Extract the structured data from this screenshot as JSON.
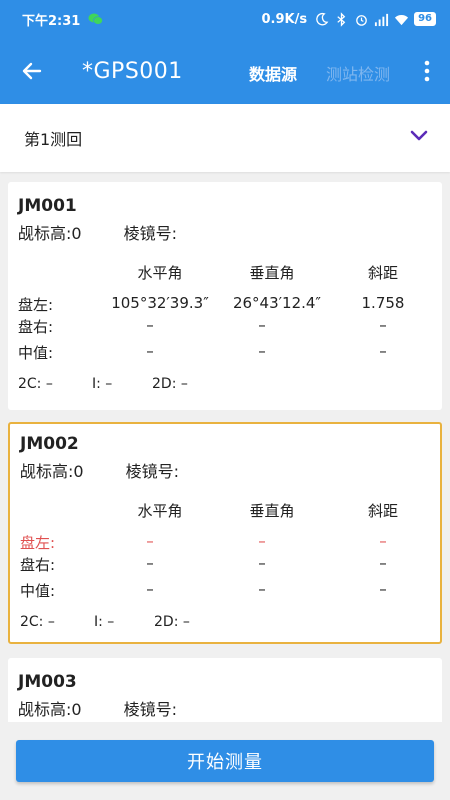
{
  "status": {
    "time": "下午2:31",
    "net_speed": "0.9K/s",
    "battery": "96"
  },
  "appbar": {
    "title": "*GPS001",
    "data_source": "数据源",
    "station_check": "测站检测"
  },
  "round_select": {
    "value": "第1测回"
  },
  "headers": {
    "h_angle": "水平角",
    "v_angle": "垂直角",
    "slope": "斜距",
    "left": "盘左:",
    "right": "盘右:",
    "mid": "中值:"
  },
  "cards": [
    {
      "id": "JM001",
      "target_height": "觇标高:0",
      "prism": "棱镜号:",
      "left": {
        "h": "105°32′39.3″",
        "v": "26°43′12.4″",
        "s": "1.758"
      },
      "right": {
        "h": "–",
        "v": "–",
        "s": "–"
      },
      "mid": {
        "h": "–",
        "v": "–",
        "s": "–"
      },
      "c2": "2C: –",
      "i": "I: –",
      "d2": "2D: –"
    },
    {
      "id": "JM002",
      "target_height": "觇标高:0",
      "prism": "棱镜号:",
      "left": {
        "h": "–",
        "v": "–",
        "s": "–"
      },
      "right": {
        "h": "–",
        "v": "–",
        "s": "–"
      },
      "mid": {
        "h": "–",
        "v": "–",
        "s": "–"
      },
      "c2": "2C: –",
      "i": "I: –",
      "d2": "2D: –"
    },
    {
      "id": "JM003",
      "target_height": "觇标高:0",
      "prism": "棱镜号:"
    }
  ],
  "start_button": "开始测量",
  "colors": {
    "primary": "#2f8ee6",
    "selected_border": "#e9b23f",
    "pending_red": "#e05050",
    "round_chevron": "#5b2bb8"
  }
}
